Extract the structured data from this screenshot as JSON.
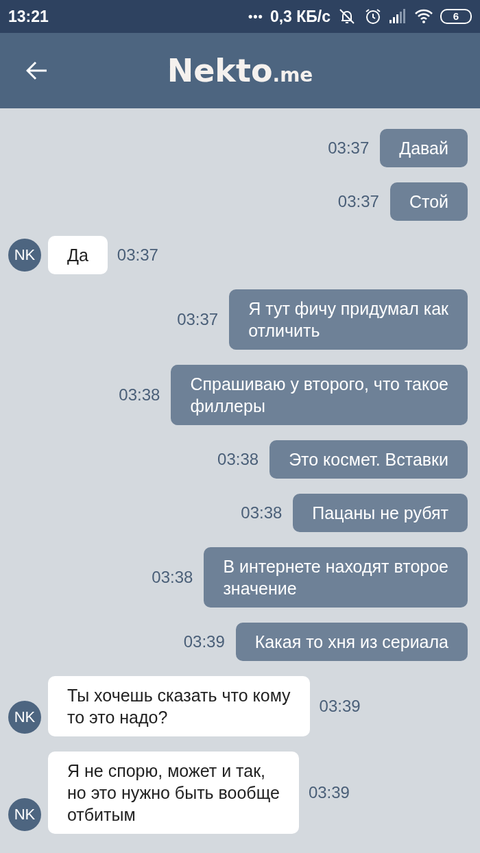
{
  "status_bar": {
    "time": "13:21",
    "dots": "•••",
    "speed": "0,3 КБ/с",
    "battery": "6"
  },
  "header": {
    "logo": "Nekto",
    "logo_suffix": ".me"
  },
  "messages": [
    {
      "kind": "out",
      "text": "Давай",
      "time": "03:37"
    },
    {
      "kind": "out",
      "text": "Стой",
      "time": "03:37"
    },
    {
      "kind": "in",
      "avatar": "NK",
      "text": "Да",
      "time": "03:37"
    },
    {
      "kind": "out",
      "text": "Я тут фичу придумал как\nотличить",
      "time": "03:37"
    },
    {
      "kind": "out",
      "text": "Спрашиваю у второго, что такое\nфиллеры",
      "time": "03:38"
    },
    {
      "kind": "out",
      "text": "Это космет. Вставки",
      "time": "03:38"
    },
    {
      "kind": "out",
      "text": "Пацаны не рубят",
      "time": "03:38"
    },
    {
      "kind": "out",
      "text": "В интернете находят второе\n значение",
      "time": "03:38"
    },
    {
      "kind": "out",
      "text": "Какая то хня из сериала",
      "time": "03:39"
    },
    {
      "kind": "in",
      "avatar": "NK",
      "text": "Ты хочешь сказать что кому\nто это надо?",
      "time": "03:39"
    },
    {
      "kind": "in",
      "avatar": "NK",
      "text": "Я не спорю, может и так,\nно это нужно быть вообще\nотбитым",
      "time": "03:39"
    }
  ]
}
